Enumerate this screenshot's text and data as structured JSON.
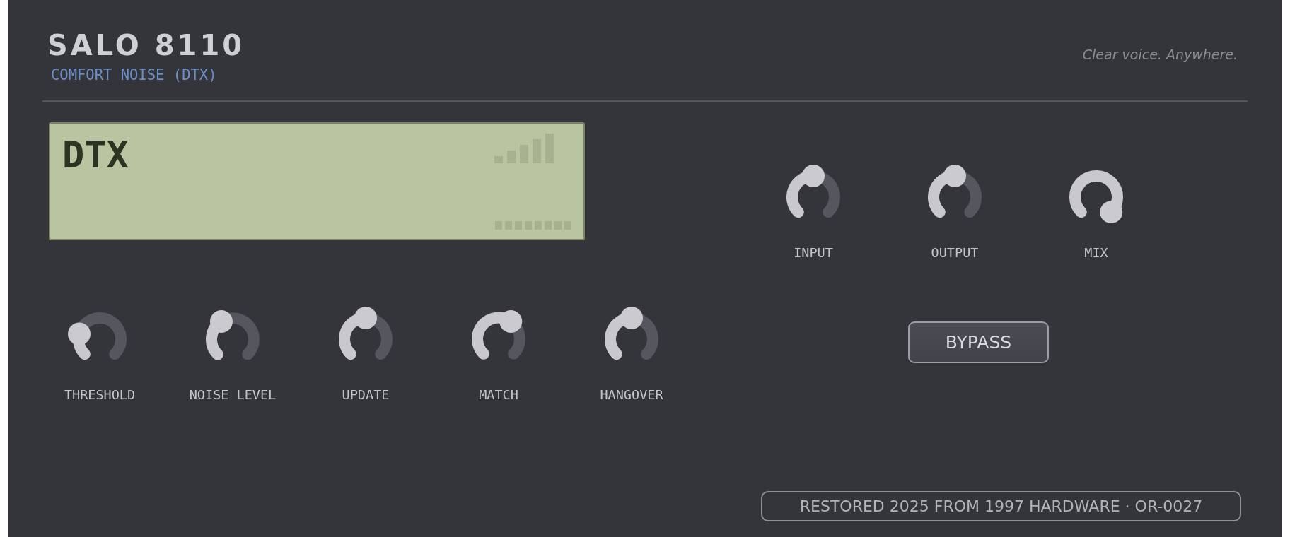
{
  "header": {
    "title": "SALO 8110",
    "subtitle": "COMFORT NOISE (DTX)",
    "tagline": "Clear voice. Anywhere."
  },
  "display": {
    "text": "DTX"
  },
  "left_knobs": [
    {
      "label": "THRESHOLD",
      "level": 0.22
    },
    {
      "label": "NOISE LEVEL",
      "level": 0.38
    },
    {
      "label": "UPDATE",
      "level": 0.5
    },
    {
      "label": "MATCH",
      "level": 0.63
    },
    {
      "label": "HANGOVER",
      "level": 0.5
    }
  ],
  "right_knobs": [
    {
      "label": "INPUT",
      "level": 0.5
    },
    {
      "label": "OUTPUT",
      "level": 0.5
    },
    {
      "label": "MIX",
      "level": 1
    }
  ],
  "bypass_button": {
    "label": "BYPASS"
  },
  "footer": {
    "text": "RESTORED 2025 FROM 1997 HARDWARE · OR-0027"
  }
}
